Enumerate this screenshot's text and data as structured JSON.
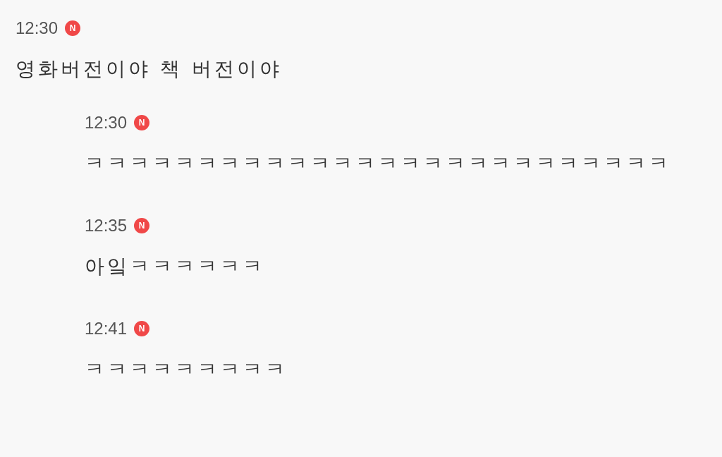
{
  "comments": [
    {
      "time": "12:30",
      "badge": "N",
      "text": "영화버전이야 책 버전이야",
      "replies": [
        {
          "time": "12:30",
          "badge": "N",
          "text": "ㅋㅋㅋㅋㅋㅋㅋㅋㅋㅋㅋㅋㅋㅋㅋㅋㅋㅋㅋㅋㅋㅋㅋㅋㅋㅋ"
        },
        {
          "time": "12:35",
          "badge": "N",
          "text": "아잌ㅋㅋㅋㅋㅋㅋ"
        },
        {
          "time": "12:41",
          "badge": "N",
          "text": "ㅋㅋㅋㅋㅋㅋㅋㅋㅋ"
        }
      ]
    }
  ]
}
